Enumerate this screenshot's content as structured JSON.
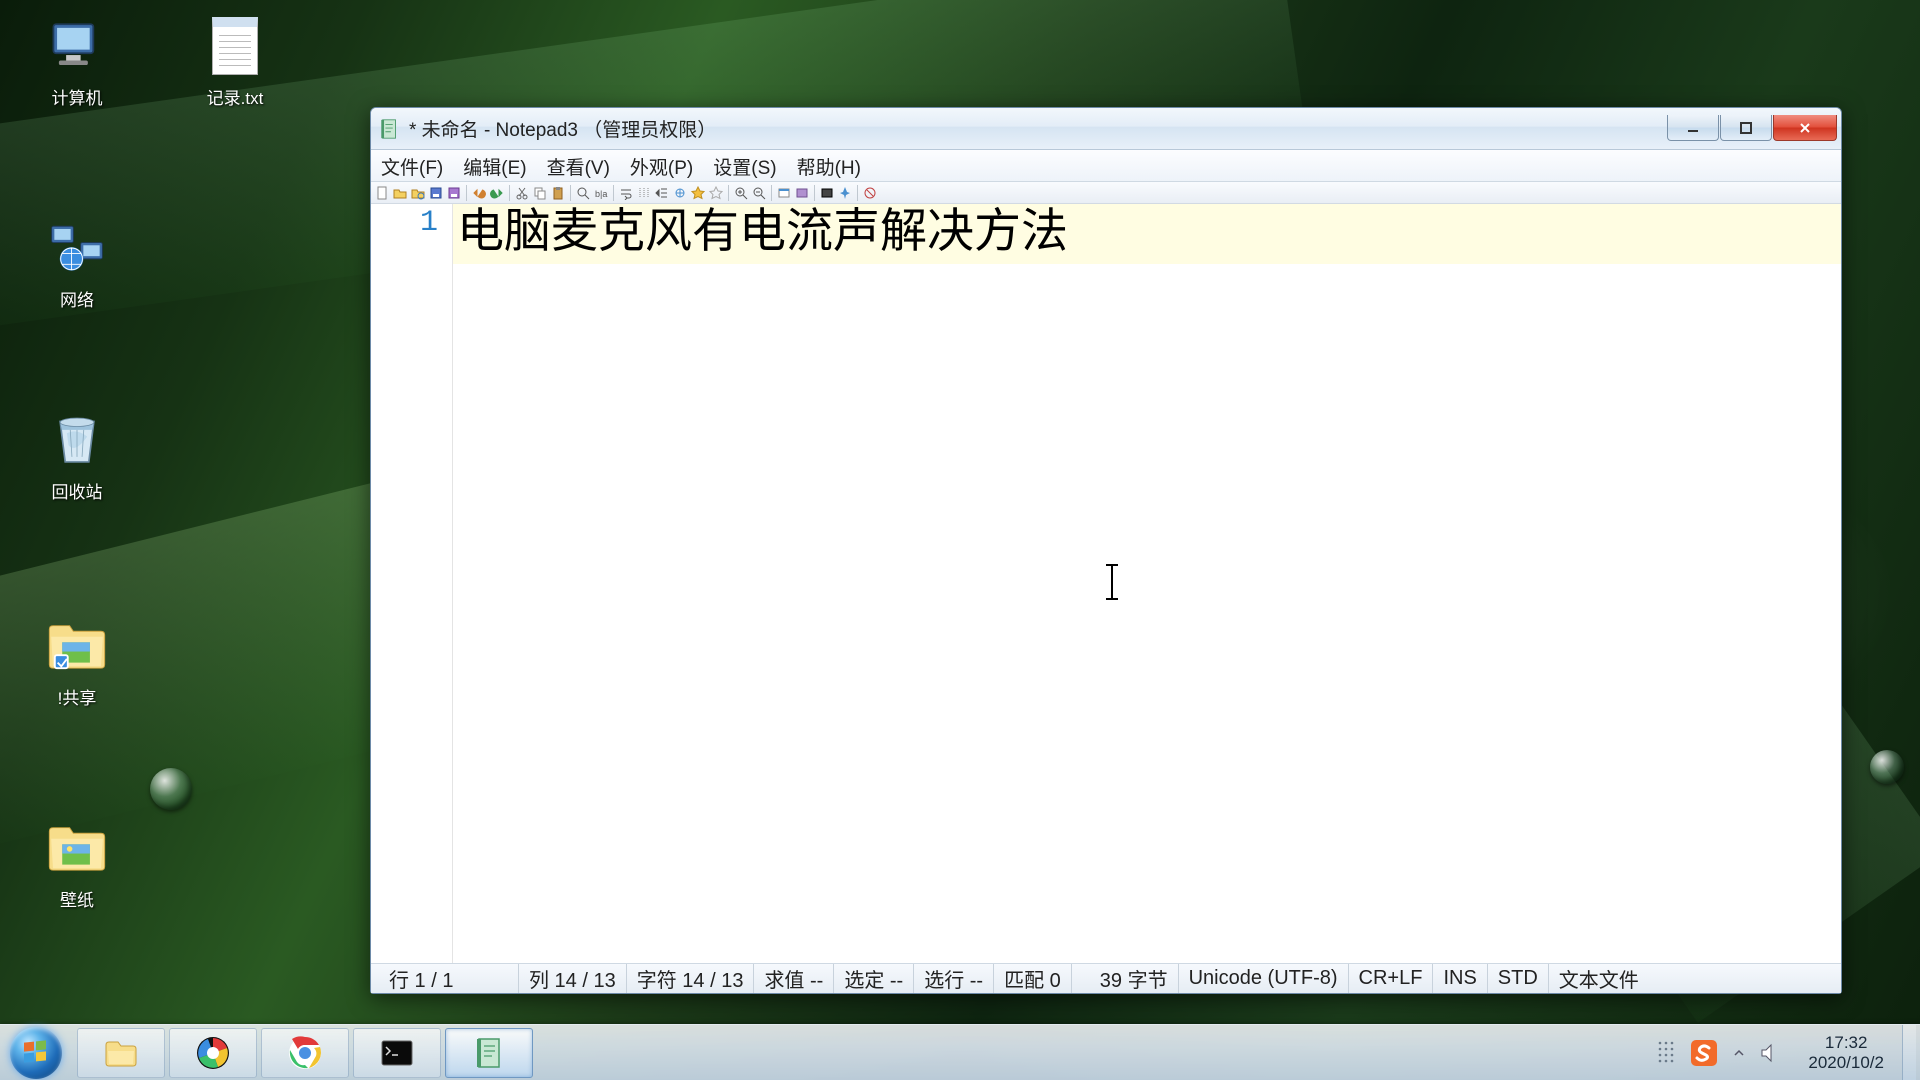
{
  "desktop_icons": {
    "computer": "计算机",
    "txtfile": "记录.txt",
    "network": "网络",
    "recycle": "回收站",
    "share": "!共享",
    "wallpaper": "壁纸"
  },
  "window": {
    "title": " * 未命名 - Notepad3 （管理员权限）",
    "menu": {
      "file": "文件(F)",
      "edit": "编辑(E)",
      "view": "查看(V)",
      "appearance": "外观(P)",
      "settings": "设置(S)",
      "help": "帮助(H)"
    },
    "editor": {
      "line_number": "1",
      "content": "电脑麦克风有电流声解决方法"
    },
    "statusbar": {
      "line": "行  1 / 1",
      "col": "列  14 / 13",
      "char": "字符  14 / 13",
      "eval": "求值  --",
      "sel": "选定  --",
      "sellines": "选行  --",
      "match": "匹配  0",
      "bytes": "39 字节",
      "encoding": "Unicode (UTF-8)",
      "eol": "CR+LF",
      "ins": "INS",
      "std": "STD",
      "filetype": "文本文件"
    }
  },
  "taskbar": {
    "time": "17:32",
    "date": "2020/10/2"
  }
}
